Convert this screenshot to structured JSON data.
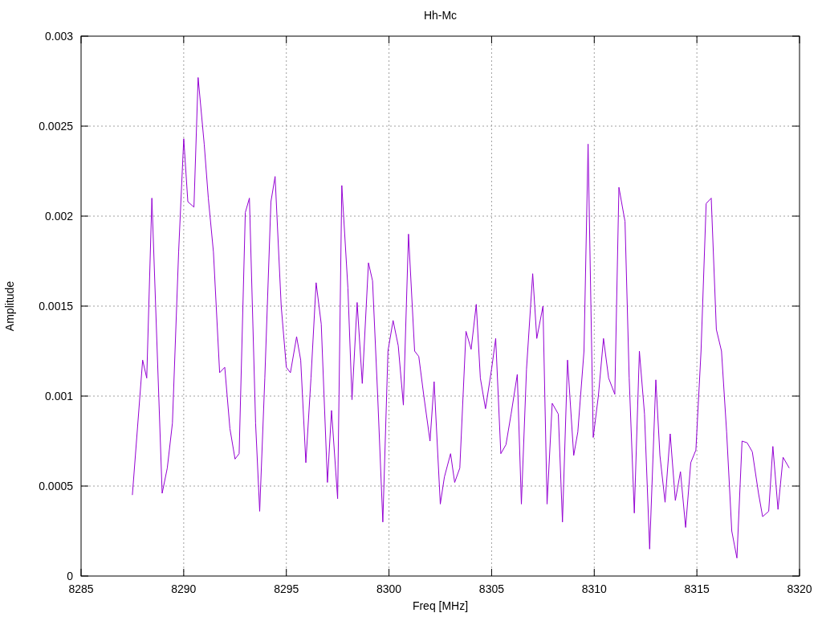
{
  "chart_data": {
    "type": "line",
    "grid": true,
    "title": "Hh-Mc",
    "xlabel": "Freq [MHz]",
    "ylabel": "Amplitude",
    "xlim": [
      8285,
      8320
    ],
    "ylim": [
      0,
      0.003
    ],
    "xticks": [
      8285,
      8290,
      8295,
      8300,
      8305,
      8310,
      8315,
      8320
    ],
    "yticks": [
      0,
      0.0005,
      0.001,
      0.0015,
      0.002,
      0.0025,
      0.003
    ],
    "x": [
      8287.5,
      8288,
      8288.2,
      8288.45,
      8288.95,
      8289.2,
      8289.45,
      8289.75,
      8290,
      8290.2,
      8290.5,
      8290.7,
      8291,
      8291.2,
      8291.45,
      8291.75,
      8292,
      8292.25,
      8292.5,
      8292.7,
      8293,
      8293.2,
      8293.5,
      8293.7,
      8293.95,
      8294.25,
      8294.45,
      8294.75,
      8295,
      8295.2,
      8295.5,
      8295.7,
      8295.95,
      8296.2,
      8296.45,
      8296.7,
      8297,
      8297.2,
      8297.5,
      8297.7,
      8298,
      8298.2,
      8298.45,
      8298.7,
      8299,
      8299.2,
      8299.45,
      8299.7,
      8299.95,
      8300.2,
      8300.45,
      8300.7,
      8300.95,
      8301.25,
      8301.45,
      8301.7,
      8302,
      8302.2,
      8302.5,
      8302.7,
      8303,
      8303.2,
      8303.45,
      8303.75,
      8304,
      8304.25,
      8304.45,
      8304.7,
      8305,
      8305.2,
      8305.45,
      8305.7,
      8305.95,
      8306.25,
      8306.45,
      8306.7,
      8307,
      8307.2,
      8307.5,
      8307.7,
      8307.95,
      8308.25,
      8308.45,
      8308.7,
      8309,
      8309.2,
      8309.5,
      8309.7,
      8309.95,
      8310.2,
      8310.45,
      8310.7,
      8311,
      8311.2,
      8311.5,
      8311.7,
      8311.95,
      8312.2,
      8312.45,
      8312.7,
      8313,
      8313.2,
      8313.45,
      8313.7,
      8313.95,
      8314.2,
      8314.45,
      8314.7,
      8314.95,
      8315.2,
      8315.45,
      8315.7,
      8315.95,
      8316.2,
      8316.45,
      8316.7,
      8316.95,
      8317.2,
      8317.45,
      8317.7,
      8318,
      8318.2,
      8318.5,
      8318.7,
      8318.95,
      8319.2,
      8319.5
    ],
    "series": [
      {
        "color": "#9400d3",
        "values": [
          0.00045,
          0.0012,
          0.0011,
          0.0021,
          0.00046,
          0.0006,
          0.00085,
          0.0018,
          0.00243,
          0.00208,
          0.00205,
          0.00277,
          0.0024,
          0.0021,
          0.0018,
          0.00113,
          0.00116,
          0.00082,
          0.00065,
          0.00068,
          0.00202,
          0.0021,
          0.00085,
          0.00036,
          0.0011,
          0.00208,
          0.00222,
          0.0015,
          0.00116,
          0.00113,
          0.00133,
          0.0012,
          0.00063,
          0.0011,
          0.00163,
          0.0014,
          0.00052,
          0.00092,
          0.00043,
          0.00217,
          0.0016,
          0.00098,
          0.00152,
          0.00107,
          0.00174,
          0.00164,
          0.001,
          0.0003,
          0.00125,
          0.00142,
          0.00128,
          0.00095,
          0.0019,
          0.00125,
          0.00122,
          0.001,
          0.00075,
          0.00108,
          0.0004,
          0.00055,
          0.00068,
          0.00052,
          0.0006,
          0.00136,
          0.00126,
          0.00151,
          0.0011,
          0.00093,
          0.00115,
          0.00132,
          0.00068,
          0.00073,
          0.0009,
          0.00112,
          0.0004,
          0.00115,
          0.00168,
          0.00132,
          0.0015,
          0.0004,
          0.00096,
          0.0009,
          0.0003,
          0.0012,
          0.00067,
          0.0008,
          0.00125,
          0.0024,
          0.00077,
          0.001,
          0.00132,
          0.0011,
          0.00101,
          0.00216,
          0.00197,
          0.0011,
          0.00035,
          0.00125,
          0.0009,
          0.00015,
          0.00109,
          0.00067,
          0.00041,
          0.00079,
          0.00042,
          0.00058,
          0.00027,
          0.00063,
          0.0007,
          0.00125,
          0.00207,
          0.0021,
          0.00137,
          0.00125,
          0.0008,
          0.00025,
          0.0001,
          0.00075,
          0.00074,
          0.00069,
          0.00046,
          0.00033,
          0.00036,
          0.00072,
          0.00037,
          0.00066,
          0.0006
        ]
      }
    ]
  }
}
